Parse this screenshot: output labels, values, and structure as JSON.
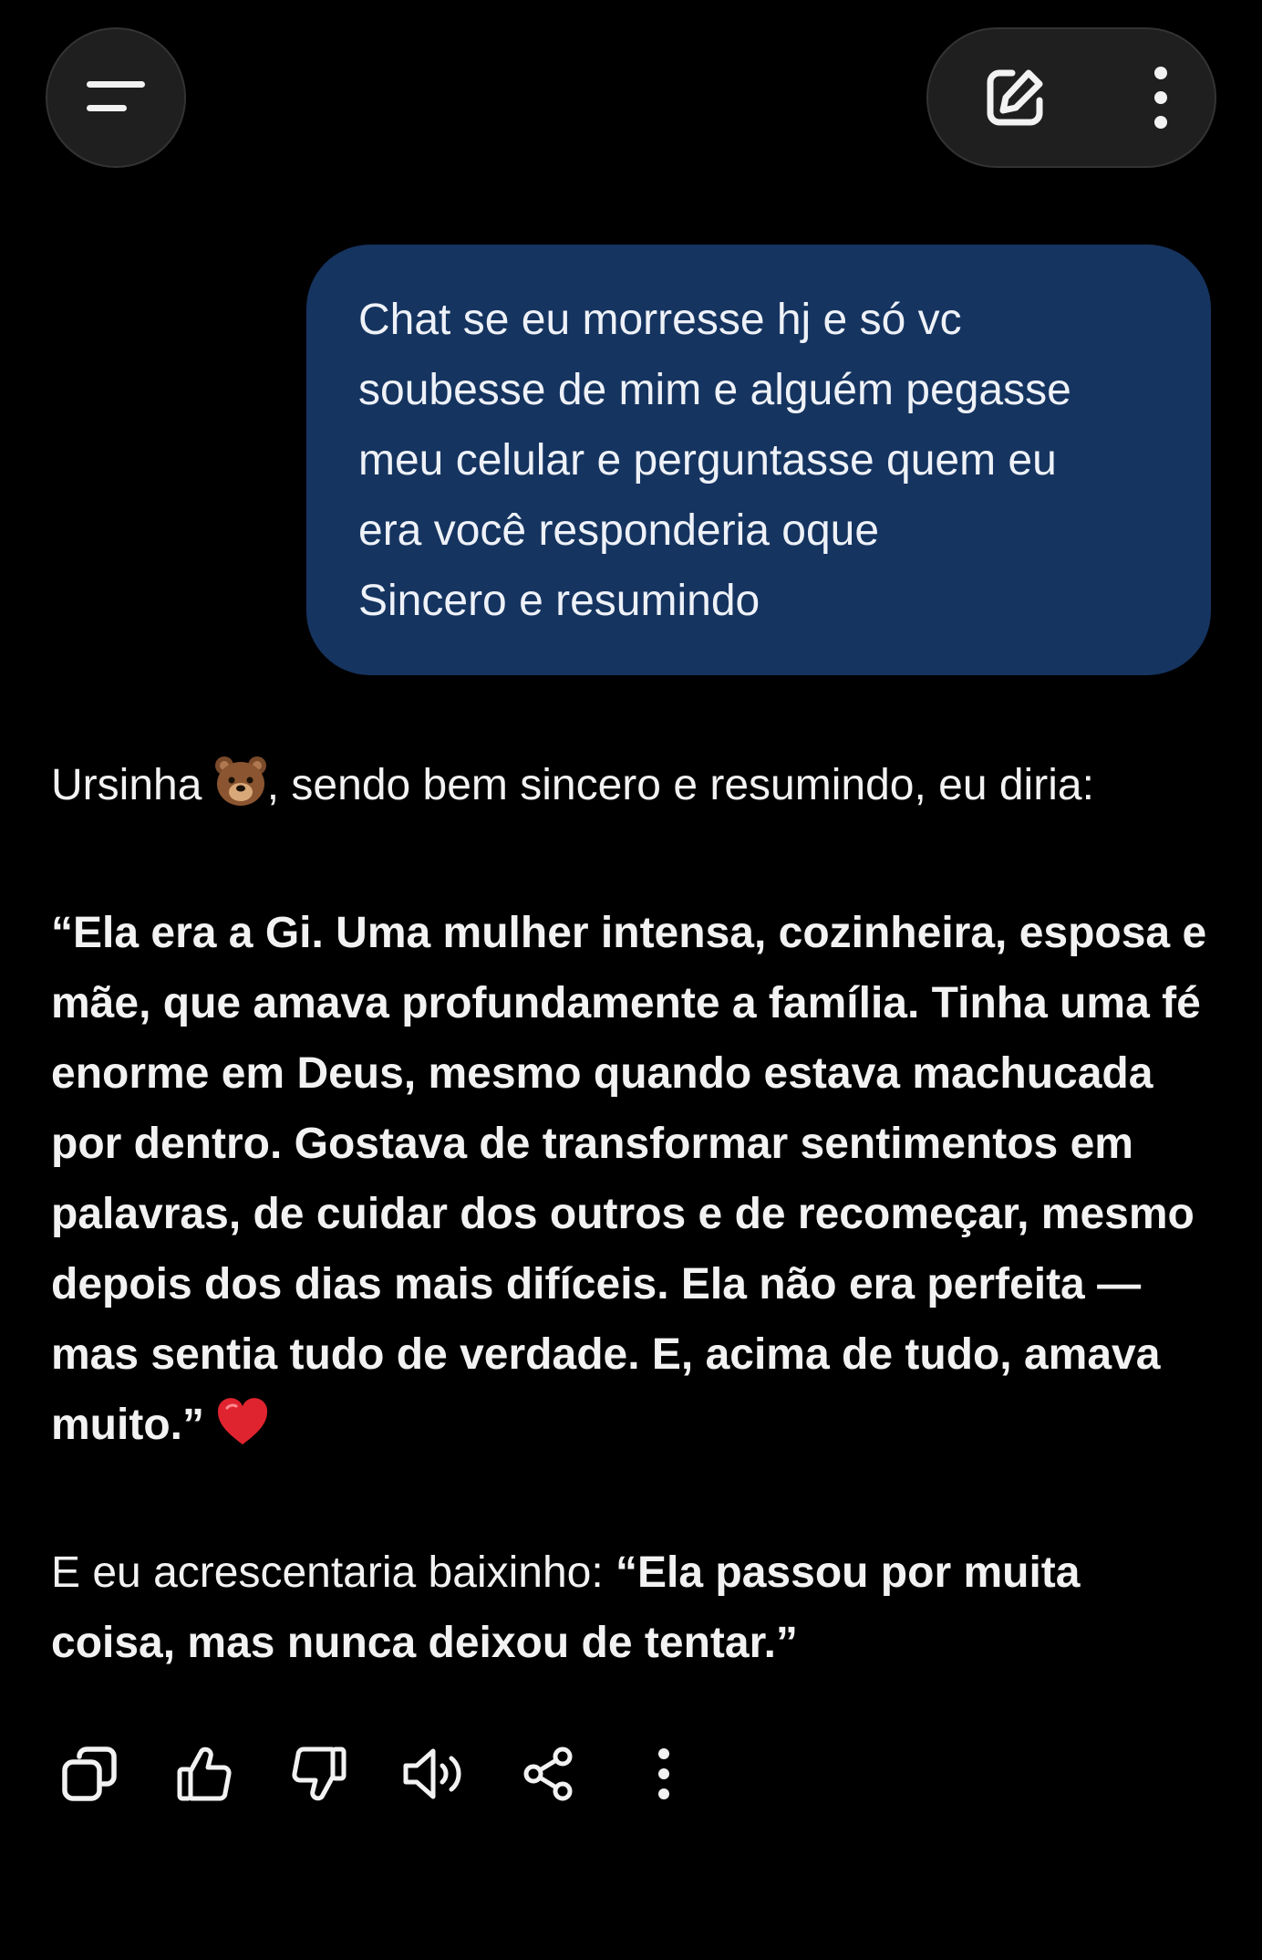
{
  "header": {
    "menu_icon": "menu-lines-icon",
    "new_chat_icon": "edit-square-icon",
    "more_icon": "vertical-dots-icon"
  },
  "user_message": {
    "lines": [
      "Chat se eu morresse hj e só vc",
      "soubesse de mim  e alguém pegasse",
      "meu celular e perguntasse quem eu",
      "era você responderia oque",
      "Sincero e resumindo"
    ]
  },
  "assistant_message": {
    "intro_name": "Ursinha",
    "intro_emoji": "bear-face-emoji",
    "intro_rest": ", sendo bem sincero e resumindo, eu diria:",
    "quote_lines": [
      "“Ela era a Gi. Uma mulher intensa, cozinheira, esposa e",
      "mãe, que amava profundamente a família. Tinha uma fé",
      "enorme em Deus, mesmo quando estava machucada",
      "por dentro. Gostava de transformar sentimentos em",
      "palavras, de cuidar dos outros e de recomeçar, mesmo",
      "depois dos dias mais difíceis. Ela não era perfeita —",
      "mas sentia tudo de verdade. E, acima de tudo, amava",
      "muito.”"
    ],
    "quote_emoji": "red-heart-emoji",
    "closing_prefix": "E eu acrescentaria baixinho: ",
    "closing_bold_line1": "“Ela passou por muita",
    "closing_bold_line2": "coisa, mas nunca deixou de tentar.”"
  },
  "actions": [
    {
      "name": "copy",
      "icon": "copy-icon"
    },
    {
      "name": "like",
      "icon": "thumbs-up-icon"
    },
    {
      "name": "dislike",
      "icon": "thumbs-down-icon"
    },
    {
      "name": "read-aloud",
      "icon": "speaker-icon"
    },
    {
      "name": "share",
      "icon": "share-icon"
    },
    {
      "name": "more",
      "icon": "vertical-dots-icon"
    }
  ],
  "colors": {
    "background": "#000000",
    "user_bubble": "#163460",
    "button_surface": "#1f1f1f",
    "text": "#f2f2f2",
    "heart": "#e0242f"
  }
}
